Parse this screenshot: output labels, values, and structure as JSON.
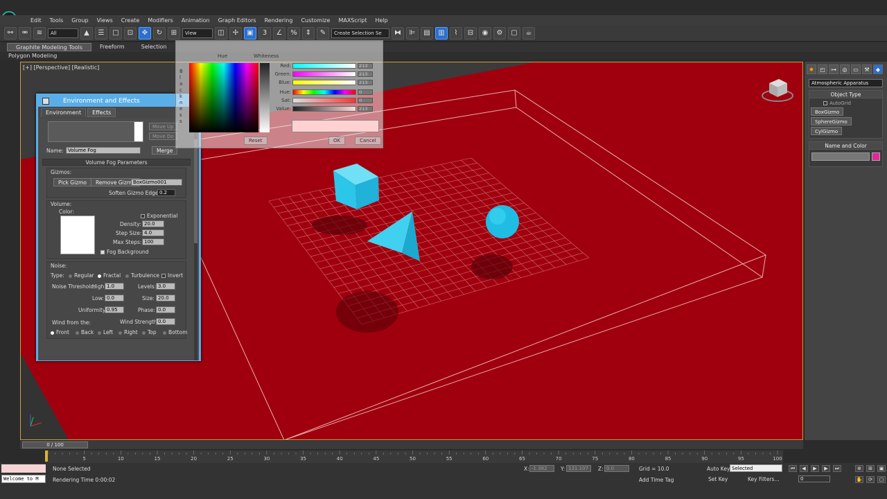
{
  "menu": [
    "Edit",
    "Tools",
    "Group",
    "Views",
    "Create",
    "Modifiers",
    "Animation",
    "Graph Editors",
    "Rendering",
    "Customize",
    "MAXScript",
    "Help"
  ],
  "toolbar": {
    "filter_all": "All",
    "ref_coord": "View",
    "create_selection_set": "Create Selection Se"
  },
  "ribbon": {
    "tabs": [
      "Graphite Modeling Tools",
      "Freeform",
      "Selection"
    ],
    "sub": "Polygon Modeling"
  },
  "viewport": {
    "label": "[+] [Perspective] [Realistic]"
  },
  "command_panel": {
    "category": "Atmospheric Apparatus",
    "object_type_title": "Object Type",
    "autogrid": "AutoGrid",
    "buttons": [
      "BoxGizmo",
      "SphereGizmo",
      "CylGizmo"
    ],
    "name_color_title": "Name and Color"
  },
  "env": {
    "title": "Environment and Effects",
    "tabs": [
      "Environment",
      "Effects"
    ],
    "move_up": "Move Up",
    "move_down": "Move Do",
    "name_label": "Name:",
    "name_value": "Volume Fog",
    "merge": "Merge",
    "section_title": "Volume Fog Parameters",
    "gizmos_label": "Gizmos:",
    "pick_gizmo": "Pick Gizmo",
    "remove_gizmo": "Remove Gizmo",
    "gizmo_select": "BoxGizmo001",
    "soften_label": "Soften Gizmo Edges:",
    "soften_value": "0.2",
    "volume_label": "Volume:",
    "color_label": "Color:",
    "exponential": "Exponential",
    "density_label": "Density:",
    "density_value": "20.0",
    "step_label": "Step Size:",
    "step_value": "4.0",
    "maxsteps_label": "Max Steps:",
    "maxsteps_value": "100",
    "fog_bg": "Fog Background",
    "noise_label": "Noise:",
    "type_label": "Type:",
    "type_regular": "Regular",
    "type_fractal": "Fractal",
    "type_turb": "Turbulence",
    "invert": "Invert",
    "noise_thresh_label": "Noise Threshold:",
    "high_label": "High:",
    "high_value": "1.0",
    "levels_label": "Levels:",
    "levels_value": "3.0",
    "low_label": "Low:",
    "low_value": "0.0",
    "size_label": "Size:",
    "size_value": "20.0",
    "uniformity_label": "Uniformity:",
    "uniformity_value": "0.95",
    "phase_label": "Phase:",
    "phase_value": "0.0",
    "wind_from_label": "Wind from the:",
    "wind_strength_label": "Wind Strength:",
    "wind_strength_value": "0.0",
    "dirs": [
      "Front",
      "Back",
      "Left",
      "Right",
      "Top",
      "Bottom"
    ]
  },
  "picker": {
    "hue_label": "Hue",
    "whiteness_label": "Whiteness",
    "blackness_label": "Blackness",
    "red_label": "Red:",
    "green_label": "Green:",
    "blue_label": "Blue:",
    "hue2_label": "Hue:",
    "sat_label": "Sat:",
    "value_label": "Value:",
    "red": "213",
    "green": "213",
    "blue": "213",
    "hue": "0",
    "sat": "0",
    "value": "213",
    "reset": "Reset",
    "ok": "OK",
    "cancel": "Cancel"
  },
  "timeline": {
    "frame": "0 / 100",
    "ticks": [
      "5",
      "10",
      "15",
      "20",
      "25",
      "30",
      "35",
      "40",
      "45",
      "50",
      "55",
      "60",
      "65",
      "70",
      "75",
      "80",
      "85",
      "90",
      "95",
      "100"
    ]
  },
  "status": {
    "welcome": "Welcome to M",
    "none_selected": "None Selected",
    "render_time": "Rendering Time  0:00:02",
    "x_label": "X:",
    "x_value": "-1.382",
    "y_label": "Y:",
    "y_value": "131.107",
    "z_label": "Z:",
    "z_value": "0.0",
    "grid": "Grid = 10.0",
    "add_time_tag": "Add Time Tag",
    "auto_key": "Auto Key",
    "selected": "Selected",
    "set_key": "Set Key",
    "key_filters": "Key Filters...",
    "frame_field": "0"
  },
  "colors": {
    "accent": "#5aaee8",
    "floor": "#a0000e",
    "objects": "#2bc6ea",
    "swatch": "#e0279a"
  }
}
